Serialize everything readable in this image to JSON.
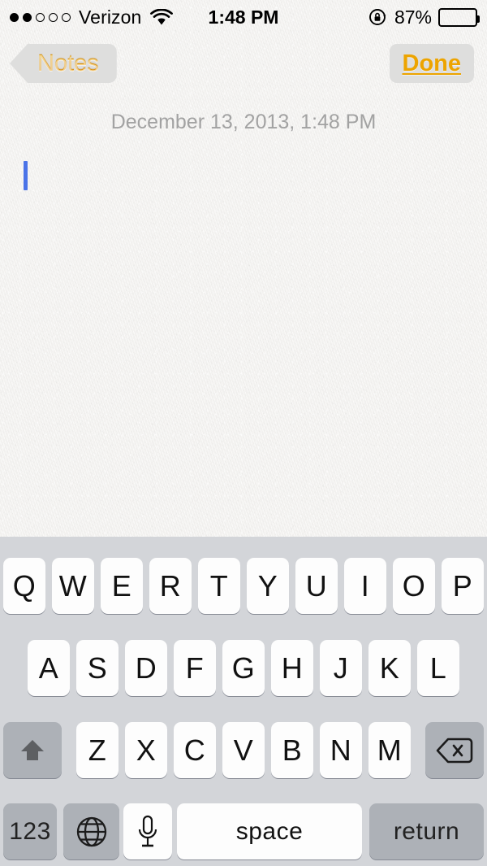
{
  "status_bar": {
    "signal_dots_total": 5,
    "signal_dots_filled": 2,
    "carrier": "Verizon",
    "wifi_icon": "wifi-icon",
    "time": "1:48 PM",
    "rotation_lock_icon": "rotation-lock-icon",
    "battery_percent": "87%",
    "battery_level": 87
  },
  "nav_bar": {
    "back_label": "Notes",
    "done_label": "Done",
    "accent_color": "#f0a30a",
    "button_bg": "#dededd"
  },
  "note": {
    "date": "December 13, 2013, 1:48 PM",
    "body_text": "",
    "placeholder": "",
    "caret_color": "#4a73e8",
    "paper_color": "#f3f2f0"
  },
  "keyboard": {
    "background": "#d3d5d9",
    "shift_state": "shifted",
    "rows": [
      {
        "keys": [
          "Q",
          "W",
          "E",
          "R",
          "T",
          "Y",
          "U",
          "I",
          "O",
          "P"
        ]
      },
      {
        "keys": [
          "A",
          "S",
          "D",
          "F",
          "G",
          "H",
          "J",
          "K",
          "L"
        ]
      },
      {
        "keys": [
          "Z",
          "X",
          "C",
          "V",
          "B",
          "N",
          "M"
        ]
      }
    ],
    "shift_key": {
      "name": "shift-key",
      "icon": "shift-arrow-icon"
    },
    "backspace_key": {
      "name": "backspace-key",
      "icon": "backspace-icon"
    },
    "numbers_key": {
      "name": "numbers-key",
      "label": "123"
    },
    "globe_key": {
      "name": "globe-key",
      "icon": "globe-icon"
    },
    "dictation_key": {
      "name": "dictation-key",
      "icon": "microphone-icon"
    },
    "space_key": {
      "name": "space-key",
      "label": "space"
    },
    "return_key": {
      "name": "return-key",
      "label": "return"
    }
  }
}
